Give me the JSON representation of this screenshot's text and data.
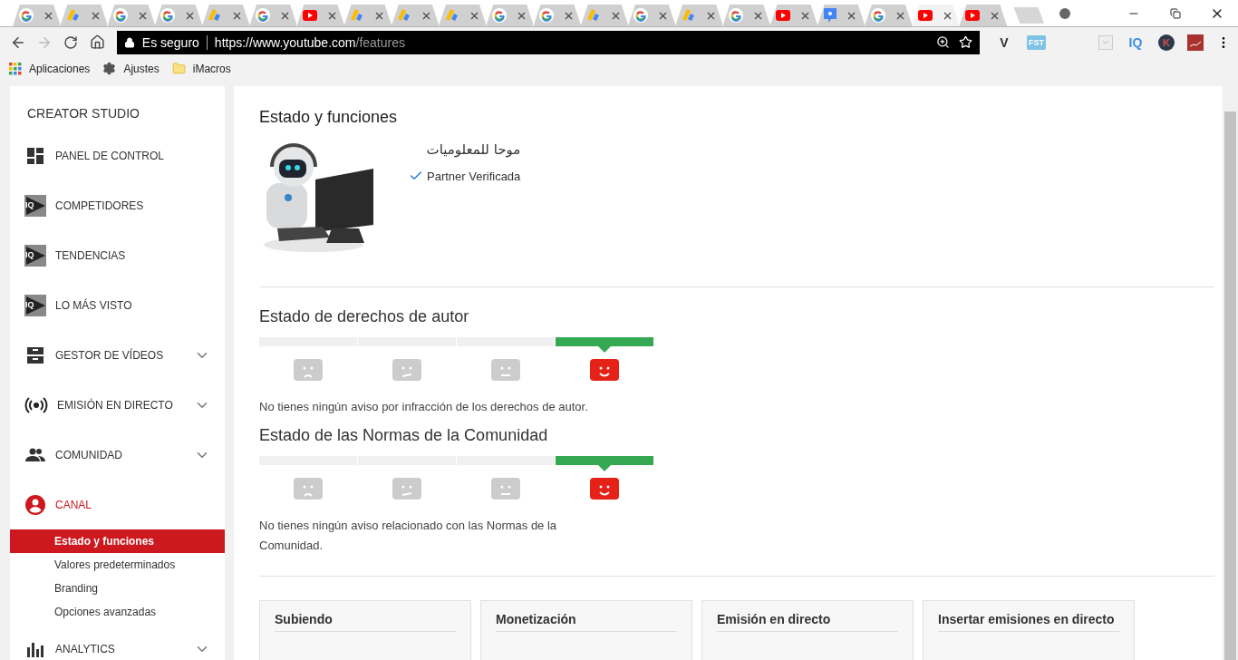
{
  "browser": {
    "tabs": [
      {
        "kind": "google",
        "selected": false
      },
      {
        "kind": "adsense",
        "selected": false
      },
      {
        "kind": "google",
        "selected": false
      },
      {
        "kind": "google",
        "selected": false
      },
      {
        "kind": "adsense",
        "selected": false
      },
      {
        "kind": "google",
        "selected": false
      },
      {
        "kind": "youtube",
        "selected": false
      },
      {
        "kind": "adsense",
        "selected": false
      },
      {
        "kind": "adsense",
        "selected": false
      },
      {
        "kind": "adsense",
        "selected": false
      },
      {
        "kind": "google",
        "selected": false
      },
      {
        "kind": "google",
        "selected": false
      },
      {
        "kind": "adsense",
        "selected": false
      },
      {
        "kind": "google",
        "selected": false
      },
      {
        "kind": "adsense",
        "selected": false
      },
      {
        "kind": "google",
        "selected": false
      },
      {
        "kind": "youtube",
        "selected": false
      },
      {
        "kind": "classroom",
        "selected": false
      },
      {
        "kind": "google",
        "selected": false
      },
      {
        "kind": "youtube",
        "selected": true
      },
      {
        "kind": "youtube",
        "selected": false
      }
    ],
    "address": {
      "secure_label": "Es seguro",
      "url_host": "https://www.youtube.com",
      "url_path": "/features"
    },
    "extensions": [
      {
        "kind": "letter",
        "text": "V"
      },
      {
        "kind": "badge",
        "text": "FST"
      },
      {
        "kind": "pocket"
      },
      {
        "kind": "letter",
        "text": "IQ"
      },
      {
        "kind": "circle",
        "text": "K"
      },
      {
        "kind": "chart"
      }
    ],
    "bookmarks": [
      {
        "kind": "apps",
        "label": "Aplicaciones"
      },
      {
        "kind": "gear",
        "label": "Ajustes"
      },
      {
        "kind": "folder",
        "label": "iMacros"
      }
    ]
  },
  "sidebar": {
    "title": "CREATOR STUDIO",
    "items": [
      {
        "kind": "dashboard",
        "label": "PANEL DE CONTROL",
        "collapsible": false,
        "selected": false
      },
      {
        "kind": "iq",
        "icon_text": "IQ",
        "label": "COMPETIDORES",
        "collapsible": false,
        "selected": false
      },
      {
        "kind": "iq",
        "icon_text": "IQ",
        "label": "TENDENCIAS",
        "collapsible": false,
        "selected": false
      },
      {
        "kind": "iq",
        "icon_text": "IQ",
        "label": "LO MÁS VISTO",
        "collapsible": false,
        "selected": false
      },
      {
        "kind": "videos",
        "label": "GESTOR DE VÍDEOS",
        "collapsible": true,
        "selected": false
      },
      {
        "kind": "live",
        "label": "EMISIÓN EN DIRECTO",
        "collapsible": true,
        "selected": false
      },
      {
        "kind": "people",
        "label": "COMUNIDAD",
        "collapsible": true,
        "selected": false
      },
      {
        "kind": "account",
        "label": "CANAL",
        "collapsible": false,
        "selected": true,
        "children": [
          {
            "label": "Estado y funciones",
            "selected": true
          },
          {
            "label": "Valores predeterminados",
            "selected": false
          },
          {
            "label": "Branding",
            "selected": false
          },
          {
            "label": "Opciones avanzadas",
            "selected": false
          }
        ]
      },
      {
        "kind": "analytics",
        "label": "ANALYTICS",
        "collapsible": true,
        "selected": false
      }
    ]
  },
  "main": {
    "title": "Estado y funciones",
    "channel": {
      "name": "موحا للمعلوميات",
      "verified": true,
      "verified_label": "Partner Verificada"
    },
    "sections": [
      {
        "title": "Estado de derechos de autor",
        "segments": [
          {
            "kind": "sad",
            "selected": false
          },
          {
            "kind": "unsure",
            "selected": false
          },
          {
            "kind": "neutral",
            "selected": false
          },
          {
            "kind": "happy",
            "selected": true
          }
        ],
        "message": "No tienes ningún aviso por infracción de los derechos de autor."
      },
      {
        "title": "Estado de las Normas de la Comunidad",
        "segments": [
          {
            "kind": "sad",
            "selected": false
          },
          {
            "kind": "unsure",
            "selected": false
          },
          {
            "kind": "neutral",
            "selected": false
          },
          {
            "kind": "happy",
            "selected": true
          }
        ],
        "message": "No tienes ningún aviso relacionado con las Normas de la Comunidad."
      }
    ],
    "cards": [
      {
        "title": "Subiendo"
      },
      {
        "title": "Monetización"
      },
      {
        "title": "Emisión en directo"
      },
      {
        "title": "Insertar emisiones en directo"
      }
    ]
  }
}
